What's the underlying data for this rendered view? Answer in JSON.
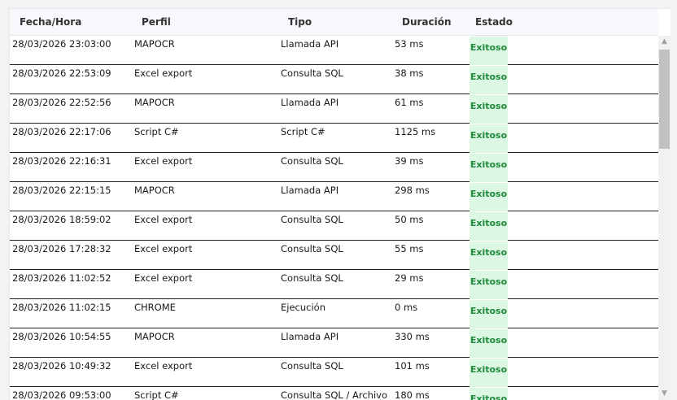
{
  "columns": [
    "Fecha/Hora",
    "Perfil",
    "Tipo",
    "Duración",
    "Estado"
  ],
  "rows": [
    {
      "fecha": "28/03/2026 23:03:00",
      "perfil": "MAPOCR",
      "tipo": "Llamada API",
      "duracion": "53 ms",
      "estado": "Exitoso"
    },
    {
      "fecha": "28/03/2026 22:53:09",
      "perfil": "Excel export",
      "tipo": "Consulta SQL",
      "duracion": "38 ms",
      "estado": "Exitoso"
    },
    {
      "fecha": "28/03/2026 22:52:56",
      "perfil": "MAPOCR",
      "tipo": "Llamada API",
      "duracion": "61 ms",
      "estado": "Exitoso"
    },
    {
      "fecha": "28/03/2026 22:17:06",
      "perfil": "Script C#",
      "tipo": "Script C#",
      "duracion": "1125 ms",
      "estado": "Exitoso"
    },
    {
      "fecha": "28/03/2026 22:16:31",
      "perfil": "Excel export",
      "tipo": "Consulta SQL",
      "duracion": "39 ms",
      "estado": "Exitoso"
    },
    {
      "fecha": "28/03/2026 22:15:15",
      "perfil": "MAPOCR",
      "tipo": "Llamada API",
      "duracion": "298 ms",
      "estado": "Exitoso"
    },
    {
      "fecha": "28/03/2026 18:59:02",
      "perfil": "Excel export",
      "tipo": "Consulta SQL",
      "duracion": "50 ms",
      "estado": "Exitoso"
    },
    {
      "fecha": "28/03/2026 17:28:32",
      "perfil": "Excel export",
      "tipo": "Consulta SQL",
      "duracion": "55 ms",
      "estado": "Exitoso"
    },
    {
      "fecha": "28/03/2026 11:02:52",
      "perfil": "Excel export",
      "tipo": "Consulta SQL",
      "duracion": "29 ms",
      "estado": "Exitoso"
    },
    {
      "fecha": "28/03/2026 11:02:15",
      "perfil": "CHROME",
      "tipo": "Ejecución",
      "duracion": "0 ms",
      "estado": "Exitoso"
    },
    {
      "fecha": "28/03/2026 10:54:55",
      "perfil": "MAPOCR",
      "tipo": "Llamada API",
      "duracion": "330 ms",
      "estado": "Exitoso"
    },
    {
      "fecha": "28/03/2026 10:49:32",
      "perfil": "Excel export",
      "tipo": "Consulta SQL",
      "duracion": "101 ms",
      "estado": "Exitoso"
    },
    {
      "fecha": "28/03/2026 09:53:00",
      "perfil": "Script C#",
      "tipo": "Consulta SQL / Archivo",
      "duracion": "180 ms",
      "estado": "Exitoso"
    }
  ],
  "scrollbar": {
    "up_icon": "chevron-up-icon",
    "down_icon": "chevron-down-icon"
  }
}
